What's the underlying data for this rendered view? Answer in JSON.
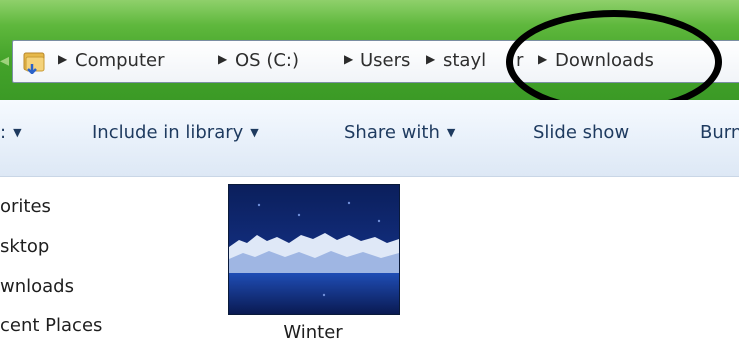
{
  "address_bar": {
    "crumbs": [
      "Computer",
      "OS (C:)",
      "Users",
      "stayl",
      "r",
      "Downloads"
    ]
  },
  "toolbar": {
    "items": [
      {
        "label": ""
      },
      {
        "label": "Include in library"
      },
      {
        "label": "Share with"
      },
      {
        "label": "Slide show"
      },
      {
        "label": "Burn"
      }
    ]
  },
  "sidebar": {
    "items": [
      {
        "label": "orites"
      },
      {
        "label": "sktop"
      },
      {
        "label": "wnloads"
      },
      {
        "label": "cent Places"
      }
    ]
  },
  "files": [
    {
      "name": "Winter",
      "icon": "winter-image-thumbnail"
    }
  ],
  "colors": {
    "titlebar": "#44a32a",
    "toolbar_text": "#1e3a5f",
    "callout": "#000000"
  }
}
